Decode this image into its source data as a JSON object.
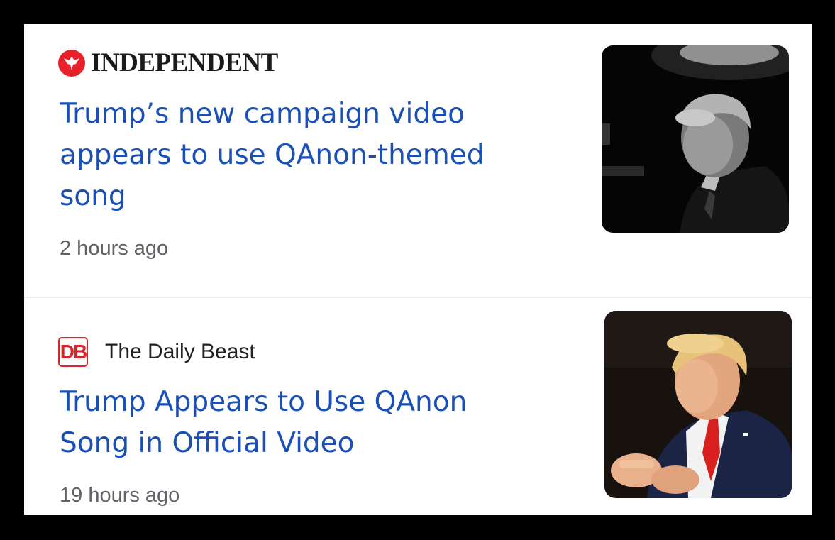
{
  "stories": [
    {
      "source": "INDEPENDENT",
      "source_icon": "independent-eagle-logo",
      "headline": "Trump’s new campaign video appears to use QAnon-themed song",
      "time": "2 hours ago",
      "thumbnail": "trump-black-and-white-photo"
    },
    {
      "source": "The Daily Beast",
      "source_icon": "daily-beast-db-logo",
      "source_logo_text": "DB",
      "headline": "Trump Appears to Use QAnon Song in Official Video",
      "time": "19 hours ago",
      "thumbnail": "trump-clapping-color-photo"
    }
  ],
  "colors": {
    "headline": "#1a4fb5",
    "independent_red": "#e8202a",
    "daily_beast_red": "#d9262c"
  }
}
